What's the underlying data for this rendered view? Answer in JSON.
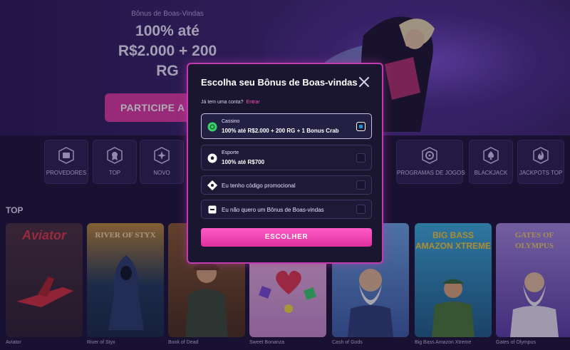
{
  "hero": {
    "kicker": "Bônus de Boas-Vindas",
    "title_line1": "100% até",
    "title_line2": "R$2.000 + 200",
    "title_line3": "RG",
    "join_button": "PARTICIPE A"
  },
  "categories": [
    {
      "label": "PROVEDORES",
      "icon": "folder-icon"
    },
    {
      "label": "TOP",
      "icon": "medal-icon"
    },
    {
      "label": "NOVO",
      "icon": "sparkle-icon"
    },
    {
      "label": "PROGRAMAS DE JOGOS",
      "icon": "wheel-icon"
    },
    {
      "label": "BLACKJACK",
      "icon": "spade-icon"
    },
    {
      "label": "JACKPOTS TOP",
      "icon": "flame-icon"
    }
  ],
  "top_section": {
    "label": "TOP"
  },
  "games": [
    {
      "name": "Aviator",
      "art_text": "Aviator",
      "color": "#3a2b3e"
    },
    {
      "name": "River of Styx",
      "art_text": "RIVER OF STYX",
      "color": "#1f3a5a"
    },
    {
      "name": "Book of Dead",
      "art_text": "",
      "color": "#5b3b24"
    },
    {
      "name": "Sweet Bonanza",
      "art_text": "",
      "color": "#d88ec9"
    },
    {
      "name": "Cash of Gods",
      "art_text": "",
      "color": "#4d7fc2"
    },
    {
      "name": "Big Bass Amazon Xtreme",
      "art_text": "BIG BASS AMAZON XTREME",
      "color": "#2f9ad0"
    },
    {
      "name": "Gates of Olympus",
      "art_text": "GATES OF OLYMPUS",
      "color": "#8e6ed0"
    }
  ],
  "modal": {
    "title": "Escolha seu Bônus de Boas-vindas",
    "login_prompt": "Já tem uma conta?",
    "login_link": "Entrar",
    "options": {
      "casino_title": "Cassino",
      "casino_sub": "100% até R$2.000 + 200 RG + 1 Bonus Crab",
      "sport_title": "Esporte",
      "sport_sub": "100% até R$700",
      "promo_code": "Eu tenho código promocional",
      "no_bonus": "Eu não quero um Bônus de Boas-vindas"
    },
    "selected_option": "casino",
    "choose_button": "ESCOLHER"
  },
  "colors": {
    "accent": "#e03aa6",
    "modal_border": "#c43ab0",
    "check": "#1e8fd8",
    "background": "#1c1336"
  }
}
